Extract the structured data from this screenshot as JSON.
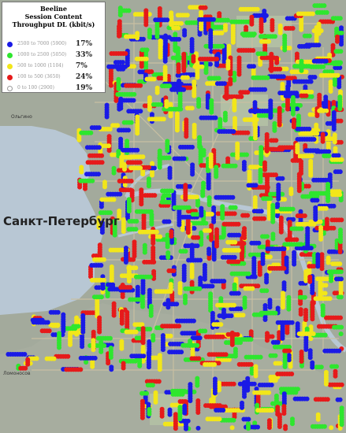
{
  "legend": {
    "title_line1": "Beeline",
    "title_line2": "Session Content",
    "title_line3": "Throughput DL (kbit/s)",
    "items": [
      {
        "color": "#1a1ae6",
        "range": "2500 to 7000 (5900)",
        "pct": "17%"
      },
      {
        "color": "#2ee62e",
        "range": "1000 to 2500 (5050)",
        "pct": "33%"
      },
      {
        "color": "#f2e61a",
        "range": "500 to 1000 (1104)",
        "pct": "7%"
      },
      {
        "color": "#e61a1a",
        "range": "100 to 500 (3650)",
        "pct": "24%"
      },
      {
        "color": "#ffffff",
        "range": "0 to 100 (2900)",
        "pct": "19%"
      }
    ]
  },
  "labels": {
    "city": "Санкт-Петербург",
    "west_town": "Ольгино",
    "southwest_town": "Ломоносов"
  },
  "colors": {
    "water": "#b8c7d4",
    "land": "#9fa89a",
    "green": "#a9b89a",
    "road": "#c7b999"
  }
}
